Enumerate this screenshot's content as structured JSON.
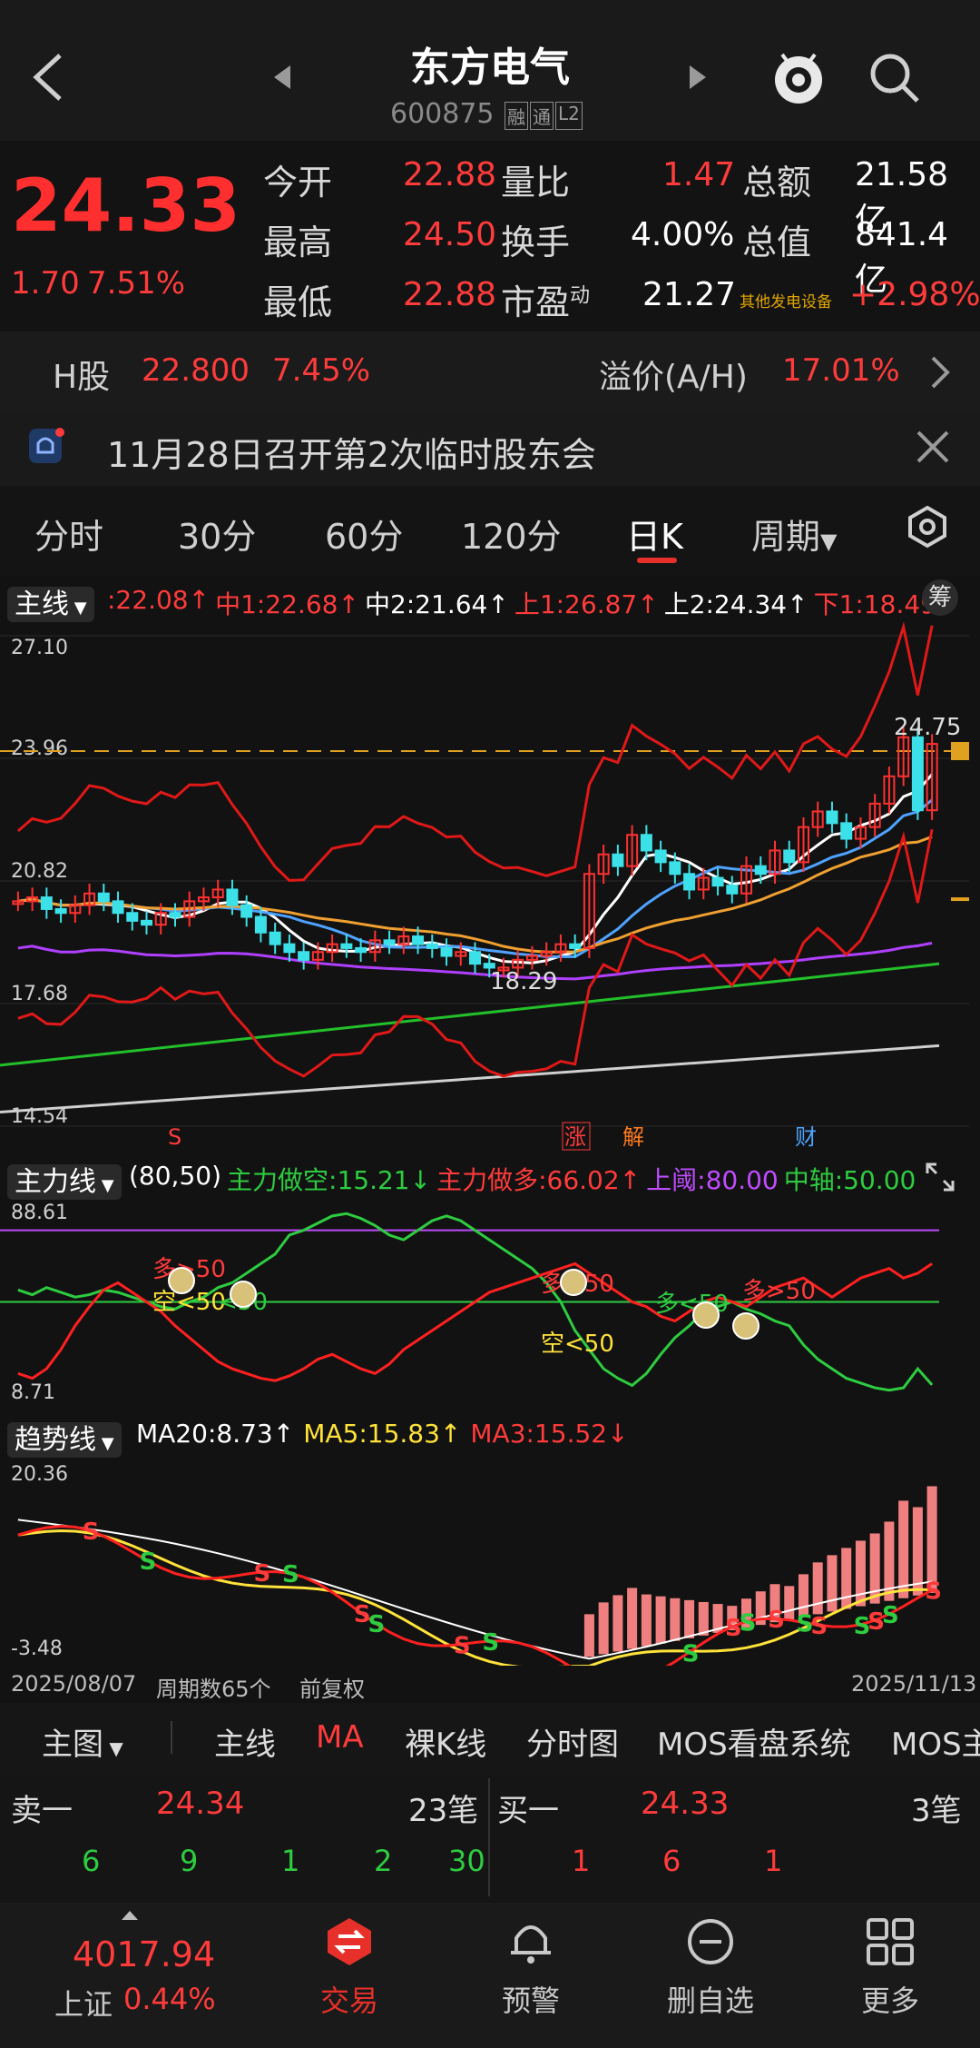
{
  "header": {
    "title": "东方电气",
    "code": "600875",
    "badges": [
      "融",
      "通",
      "L2"
    ]
  },
  "quote": {
    "price": "24.33",
    "change": "1.70",
    "change_pct": "7.51%",
    "rows": [
      {
        "l1": "今开",
        "v1": "22.88",
        "l2": "量比",
        "v2": "1.47",
        "l3": "总额",
        "v3": "21.58亿"
      },
      {
        "l1": "最高",
        "v1": "24.50",
        "l2": "换手",
        "v2": "4.00%",
        "l3": "总值",
        "v3": "841.4亿"
      },
      {
        "l1": "最低",
        "v1": "22.88",
        "l2": "市盈",
        "l2sup": "动",
        "v2": "21.27",
        "l3": "其他发电设备",
        "v3": "+2.98%"
      }
    ]
  },
  "hshare": {
    "label": "H股",
    "price": "22.800",
    "pct": "7.45%",
    "premium_label": "溢价(A/H)",
    "premium": "17.01%"
  },
  "notice": {
    "text": "11月28日召开第2次临时股东会"
  },
  "tabs": [
    "分时",
    "30分",
    "60分",
    "120分",
    "日K",
    "周期"
  ],
  "main_chart": {
    "selector": "主线",
    "legend": [
      {
        "text": ":22.08↑",
        "color": "#ff3b3b"
      },
      {
        "text": "中1:22.68↑",
        "color": "#ff3b3b"
      },
      {
        "text": "中2:21.64↑",
        "color": "#ffffff"
      },
      {
        "text": "上1:26.87↑",
        "color": "#ff3b3b"
      },
      {
        "text": "上2:24.34↑",
        "color": "#ffffff"
      },
      {
        "text": "下1:18.49↓",
        "color": "#ff3b3b"
      }
    ],
    "chip_button": "筹",
    "y_labels": [
      "27.10",
      "23.96",
      "20.82",
      "17.68",
      "14.54"
    ],
    "high_label": "24.75",
    "low_label": "18.29",
    "events": [
      "S",
      "涨",
      "解",
      "财"
    ]
  },
  "power_chart": {
    "selector": "主力线",
    "legend": [
      {
        "text": "(80,50)",
        "color": "#ffffff"
      },
      {
        "text": "主力做空:15.21↓",
        "color": "#2ecc40"
      },
      {
        "text": "主力做多:66.02↑",
        "color": "#ff3b3b"
      },
      {
        "text": "上阈:80.00",
        "color": "#c04bff"
      },
      {
        "text": "中轴:50.00",
        "color": "#2ecc40"
      }
    ],
    "y_labels": [
      "88.61",
      "8.71"
    ],
    "annotations": [
      {
        "text": "多>50",
        "color": "#ff3b3b"
      },
      {
        "text": "空<50",
        "color": "#ffe23a"
      },
      {
        "text": "<50",
        "color": "#2ecc40"
      },
      {
        "text": "多>50",
        "color": "#ff3b3b"
      },
      {
        "text": "空<50",
        "color": "#ffe23a"
      },
      {
        "text": "多<50",
        "color": "#2ecc40"
      },
      {
        "text": "多>50",
        "color": "#ff3b3b"
      }
    ]
  },
  "trend_chart": {
    "selector": "趋势线",
    "legend": [
      {
        "text": "MA20:8.73↑",
        "color": "#ffffff"
      },
      {
        "text": "MA5:15.83↑",
        "color": "#ffe23a"
      },
      {
        "text": "MA3:15.52↓",
        "color": "#ff3b3b"
      }
    ],
    "y_labels": [
      "20.36",
      "-3.48"
    ],
    "marker_s": "S"
  },
  "axis": {
    "start_date": "2025/08/07",
    "count": "周期数65个",
    "adjust": "前复权",
    "end_date": "2025/11/13"
  },
  "bottom_menu": {
    "main": "主图",
    "items": [
      "主线",
      "MA",
      "裸K线",
      "分时图",
      "MOS看盘系统",
      "MOS主"
    ]
  },
  "orderbook": {
    "sell_label": "卖一",
    "sell_price": "24.34",
    "sell_count": "23笔",
    "sell_queue": [
      "6",
      "9",
      "1",
      "2",
      "30"
    ],
    "buy_label": "买一",
    "buy_price": "24.33",
    "buy_count": "3笔",
    "buy_queue": [
      "1",
      "6",
      "1"
    ]
  },
  "nav": {
    "index_value": "4017.94",
    "index_name": "上证",
    "index_pct": "0.44%",
    "items": [
      {
        "label": "交易",
        "icon": "trade-icon"
      },
      {
        "label": "预警",
        "icon": "bell-icon"
      },
      {
        "label": "删自选",
        "icon": "remove-icon"
      },
      {
        "label": "更多",
        "icon": "grid-icon"
      }
    ]
  },
  "colors": {
    "up": "#ff3b3b",
    "down": "#2ecc40",
    "accent": "#e8302a",
    "background": "#121212"
  },
  "chart_data": [
    {
      "type": "candlestick",
      "title": "",
      "ylim": [
        14.54,
        27.1
      ],
      "y_ticks": [
        27.1,
        23.96,
        20.82,
        17.68,
        14.54
      ],
      "x_range": [
        "2025/08/07",
        "2025/11/13"
      ],
      "close": [
        20.3,
        20.4,
        20.1,
        20.0,
        20.2,
        20.5,
        20.3,
        20.0,
        19.8,
        19.7,
        20.0,
        19.9,
        20.3,
        20.4,
        20.6,
        20.2,
        19.9,
        19.5,
        19.2,
        19.0,
        18.8,
        19.0,
        19.2,
        19.1,
        19.0,
        19.3,
        19.2,
        19.4,
        19.2,
        19.1,
        18.9,
        19.0,
        18.7,
        18.6,
        18.6,
        18.8,
        18.9,
        19.0,
        19.2,
        19.1,
        21.0,
        21.5,
        21.2,
        22.0,
        21.6,
        21.3,
        21.0,
        20.6,
        20.9,
        20.7,
        20.5,
        21.2,
        21.0,
        21.6,
        21.3,
        22.2,
        22.6,
        22.3,
        21.9,
        22.2,
        22.8,
        23.5,
        24.5,
        22.63,
        24.33
      ]
    },
    {
      "type": "line",
      "title": "",
      "ylim": [
        8.71,
        88.61
      ],
      "series": [
        {
          "name": "主力做空",
          "values": [
            55,
            53,
            56,
            54,
            52,
            53,
            55,
            54,
            52,
            50,
            48,
            47,
            50,
            52,
            56,
            58,
            62,
            66,
            70,
            78,
            80,
            83,
            86,
            87,
            85,
            82,
            78,
            76,
            80,
            84,
            86,
            84,
            80,
            76,
            72,
            68,
            64,
            58,
            50,
            38,
            30,
            22,
            18,
            15,
            20,
            28,
            35,
            40,
            46,
            48,
            50,
            47,
            45,
            42,
            40,
            32,
            26,
            22,
            18,
            16,
            14,
            13,
            14,
            22,
            15.21
          ]
        },
        {
          "name": "主力做多",
          "values": [
            20,
            18,
            22,
            30,
            40,
            48,
            55,
            58,
            54,
            50,
            46,
            40,
            35,
            30,
            25,
            22,
            20,
            18,
            17,
            19,
            22,
            26,
            28,
            25,
            22,
            20,
            24,
            30,
            34,
            38,
            42,
            46,
            50,
            54,
            56,
            58,
            60,
            62,
            64,
            66,
            62,
            58,
            54,
            50,
            48,
            44,
            42,
            46,
            50,
            52,
            50,
            48,
            52,
            56,
            58,
            60,
            56,
            52,
            56,
            60,
            62,
            64,
            60,
            62,
            66.02
          ]
        }
      ]
    },
    {
      "type": "bar",
      "title": "",
      "ylim": [
        -3.48,
        20.36
      ],
      "values": [
        0,
        0,
        0,
        0,
        0,
        0,
        0,
        0,
        0,
        0,
        0,
        0,
        0,
        0,
        0,
        0,
        0,
        0,
        0,
        0,
        0,
        0,
        0,
        0,
        0,
        0,
        0,
        0,
        0,
        0,
        0,
        0,
        0,
        0,
        0,
        0,
        0,
        0,
        0,
        0,
        6,
        8,
        9,
        10,
        8,
        7,
        6,
        5,
        4,
        3,
        2,
        3,
        4,
        5,
        4,
        6,
        8,
        9,
        10,
        11,
        12,
        14,
        18,
        16,
        20
      ]
    }
  ]
}
